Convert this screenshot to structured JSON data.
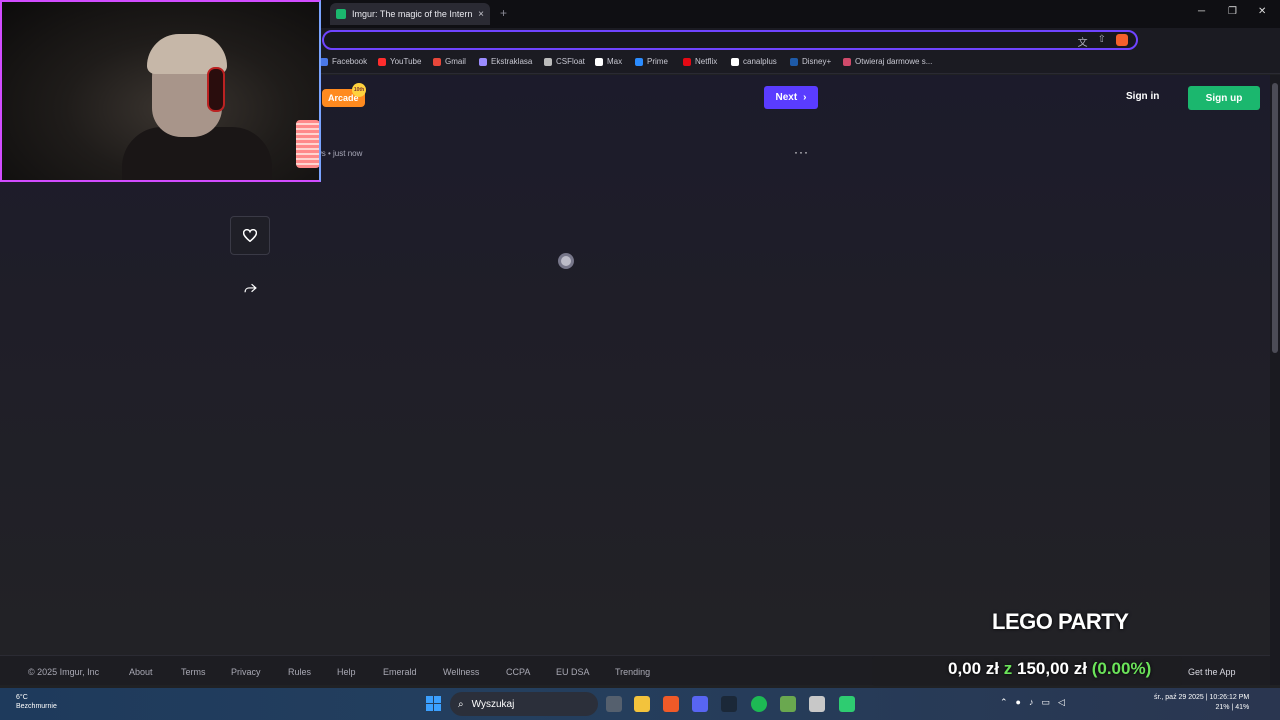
{
  "browser": {
    "tab_title": "Imgur: The magic of the Internet",
    "tab_close": "×",
    "new_tab": "+",
    "window_controls": {
      "minimize": "─",
      "maximize": "❐",
      "close": "✕"
    }
  },
  "bookmarks": [
    {
      "label": "Facebook",
      "color": "#4a78e8"
    },
    {
      "label": "YouTube",
      "color": "#ff2d2d"
    },
    {
      "label": "Gmail",
      "color": "#e8473a"
    },
    {
      "label": "Ekstraklasa",
      "color": "#9b8cff"
    },
    {
      "label": "CSFloat",
      "color": "#bbbbbb"
    },
    {
      "label": "Max",
      "color": "#ffffff"
    },
    {
      "label": "Prime",
      "color": "#2b8cff"
    },
    {
      "label": "Netflix",
      "color": "#e50914"
    },
    {
      "label": "canalplus",
      "color": "#ffffff"
    },
    {
      "label": "Disney+",
      "color": "#1e5aa8"
    },
    {
      "label": "Otwieraj darmowe s...",
      "color": "#d04a6a"
    }
  ],
  "header": {
    "arcade_label": "Arcade",
    "arcade_badge": "10th",
    "next_label": "Next",
    "signin_label": "Sign in",
    "signup_label": "Sign up"
  },
  "post": {
    "meta": "ws • just now",
    "more": "···"
  },
  "actions": {
    "like_icon": "heart-icon",
    "share_icon": "share-icon"
  },
  "footer": {
    "copyright": "© 2025 Imgur, Inc",
    "links": [
      "About",
      "Terms",
      "Privacy",
      "Rules",
      "Help",
      "Emerald",
      "Wellness",
      "CCPA",
      "EU DSA",
      "Trending"
    ],
    "get_app": "Get the App"
  },
  "overlay": {
    "game_title": "LEGO PARTY",
    "donation_current": "0,00 zł",
    "donation_sep": "z",
    "donation_goal": "150,00 zł",
    "donation_pct": "(0.00%)"
  },
  "taskbar": {
    "weather_temp": "6°C",
    "weather_desc": "Bezchmurnie",
    "search_placeholder": "Wyszukaj",
    "clock_date": "śr., paź 29 2025 | 10:26:12 PM",
    "clock_battery": "21% | 41%"
  }
}
